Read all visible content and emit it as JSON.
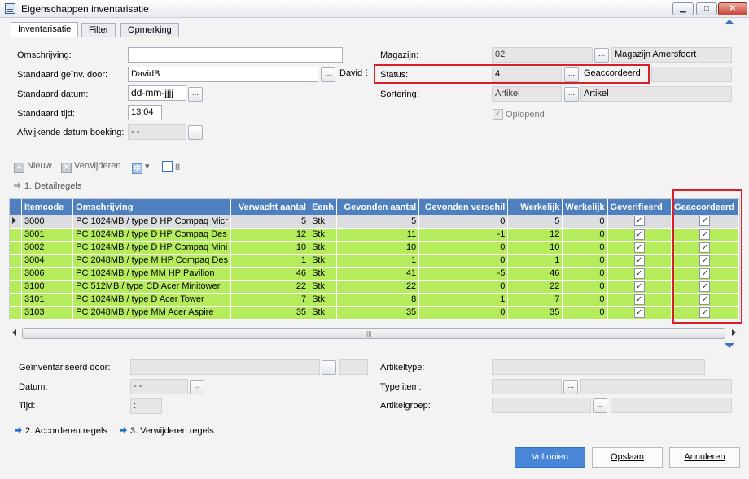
{
  "window": {
    "title": "Eigenschappen inventarisatie"
  },
  "tabs": [
    "Inventarisatie",
    "Filter",
    "Opmerking"
  ],
  "form": {
    "omschrijving_label": "Omschrijving:",
    "omschrijving_value": "",
    "geinv_door_label": "Standaard geïnv. door:",
    "geinv_door_value": "DavidB",
    "geinv_door_name": "David Brouw",
    "datum_label": "Standaard datum:",
    "datum_value": "dd-mm-jjjj",
    "tijd_label": "Standaard tijd:",
    "tijd_value": "13:04",
    "afw_datum_label": "Afwijkende datum boeking:",
    "afw_datum_value": "- -",
    "magazijn_label": "Magazijn:",
    "magazijn_value": "02",
    "magazijn_name": "Magazijn Amersfoort",
    "status_label": "Status:",
    "status_value": "4",
    "status_name": "Geaccordeerd",
    "sortering_label": "Sortering:",
    "sortering_value": "Artikel",
    "sortering_name": "Artikel",
    "oplopend_label": "Oplopend"
  },
  "toolbar": {
    "new": "Nieuw",
    "delete": "Verwijderen",
    "count": "8"
  },
  "section1": "1. Detailregels",
  "grid": {
    "columns": [
      "Itemcode",
      "Omschrijving",
      "Verwacht aantal",
      "Eenh",
      "Gevonden aantal",
      "Gevonden verschil",
      "Werkelijk",
      "Werkelijk",
      "Geverifieerd",
      "Geaccordeerd"
    ],
    "rows": [
      [
        "3000",
        "PC 1024MB / type D HP Compaq Micr",
        "5",
        "Stk",
        "5",
        "0",
        "5",
        "0"
      ],
      [
        "3001",
        "PC 1024MB / type D HP Compaq Des",
        "12",
        "Stk",
        "11",
        "-1",
        "12",
        "0"
      ],
      [
        "3002",
        "PC 1024MB / type D HP Compaq Mini",
        "10",
        "Stk",
        "10",
        "0",
        "10",
        "0"
      ],
      [
        "3004",
        "PC 2048MB / type M HP Compaq Des",
        "1",
        "Stk",
        "1",
        "0",
        "1",
        "0"
      ],
      [
        "3006",
        "PC 1024MB / type MM HP Pavilion",
        "46",
        "Stk",
        "41",
        "-5",
        "46",
        "0"
      ],
      [
        "3100",
        "PC 512MB / type CD Acer Minitower",
        "22",
        "Stk",
        "22",
        "0",
        "22",
        "0"
      ],
      [
        "3101",
        "PC 1024MB / type D Acer Tower",
        "7",
        "Stk",
        "8",
        "1",
        "7",
        "0"
      ],
      [
        "3103",
        "PC 2048MB / type MM Acer Aspire",
        "35",
        "Stk",
        "35",
        "0",
        "35",
        "0"
      ]
    ],
    "checkmark": "✓"
  },
  "details": {
    "geinv_door_label": "Geïnventariseerd door:",
    "datum_label": "Datum:",
    "datum_value": "- -",
    "tijd_label": "Tijd:",
    "tijd_value": ":",
    "artikeltype_label": "Artikeltype:",
    "type_item_label": "Type item:",
    "artikelgroep_label": "Artikelgroep:"
  },
  "links": {
    "accorderen": "2. Accorderen regels",
    "verwijderen": "3. Verwijderen regels"
  },
  "buttons": {
    "voltooien": "Voltooien",
    "opslaan": "Opslaan",
    "annuleren": "Annuleren"
  },
  "colors": {
    "header": "#4e80bf",
    "row": "#b5ec5c",
    "highlight": "#d9202a",
    "primary": "#4a86d8"
  }
}
